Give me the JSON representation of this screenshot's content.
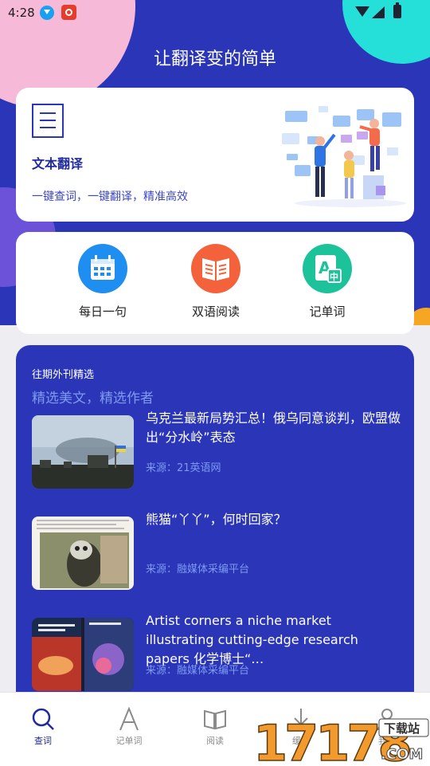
{
  "status": {
    "time": "4:28"
  },
  "header": {
    "title": "让翻译变的简单"
  },
  "text_translate": {
    "title": "文本翻译",
    "subtitle": "一键查词，一键翻译，精准高效"
  },
  "features": [
    {
      "label": "每日一句",
      "icon": "calendar-icon",
      "color": "#1e8ef0"
    },
    {
      "label": "双语阅读",
      "icon": "open-book-icon",
      "color": "#f3623a"
    },
    {
      "label": "记单词",
      "icon": "word-card-icon",
      "color": "#1cc39a"
    }
  ],
  "journal": {
    "heading": "往期外刊精选",
    "subheading": "精选美文，精选作者",
    "articles": [
      {
        "title": "乌克兰最新局势汇总！俄乌同意谈判，欧盟做出“分水岭”表态",
        "source": "来源：21英语网"
      },
      {
        "title": "熊猫“丫丫”，何时回家？",
        "source": "来源：融媒体采编平台"
      },
      {
        "title": "Artist corners a niche market illustrating cutting-edge research papers 化学博士“…",
        "source": "来源：融媒体采编平台"
      }
    ]
  },
  "tabs": [
    {
      "label": "查词",
      "active": true
    },
    {
      "label": "记单词",
      "active": false
    },
    {
      "label": "阅读",
      "active": false
    },
    {
      "label": "缓存",
      "active": false
    },
    {
      "label": "我的",
      "active": false
    }
  ],
  "watermark": {
    "main": "17178",
    "suffix": ".COM",
    "tag": "下载站"
  }
}
